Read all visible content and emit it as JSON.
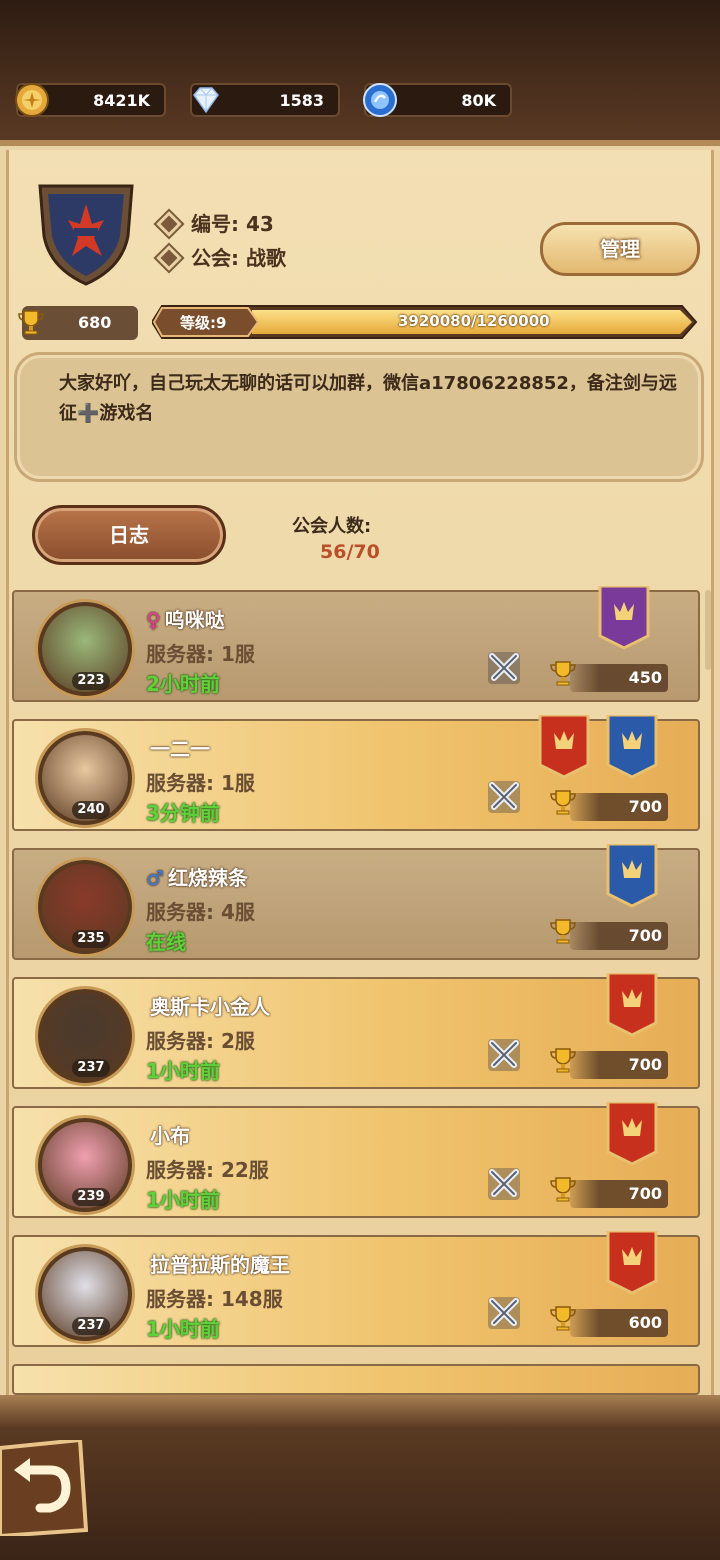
{
  "resources": [
    {
      "icon": "gold-coin-icon",
      "value": "8421K"
    },
    {
      "icon": "diamond-icon",
      "value": "1583"
    },
    {
      "icon": "blue-orb-icon",
      "value": "80K"
    }
  ],
  "guild": {
    "id_label": "编号: 43",
    "name_label": "公会: 战歌",
    "manage_label": "管理",
    "trophy_value": "680",
    "level_label": "等级:9",
    "exp_text": "3920080/1260000",
    "description": "大家好吖，自己玩太无聊的话可以加群，微信a17806228852，备注剑与远征➕游戏名",
    "log_label": "日志",
    "member_count_label": "公会人数:",
    "member_count_value": "56/70"
  },
  "members": [
    {
      "gender": "♀",
      "name": "呜咪哒",
      "server": "服务器: 1服",
      "status": "2小时前",
      "level": "223",
      "score": "450",
      "style": "plain"
    },
    {
      "gender": "",
      "name": "一二一",
      "server": "服务器: 1服",
      "status": "3分钟前",
      "level": "240",
      "score": "700",
      "style": "gold"
    },
    {
      "gender": "♂",
      "name": "红烧辣条",
      "server": "服务器: 4服",
      "status": "在线",
      "level": "235",
      "score": "700",
      "style": "plain"
    },
    {
      "gender": "",
      "name": "奥斯卡小金人",
      "server": "服务器: 2服",
      "status": "1小时前",
      "level": "237",
      "score": "700",
      "style": "gold"
    },
    {
      "gender": "",
      "name": "小布",
      "server": "服务器: 22服",
      "status": "1小时前",
      "level": "239",
      "score": "700",
      "style": "gold"
    },
    {
      "gender": "",
      "name": "拉普拉斯的魔王",
      "server": "服务器: 148服",
      "status": "1小时前",
      "level": "237",
      "score": "600",
      "style": "gold"
    }
  ],
  "colors": {
    "status_green": "#5fd23a",
    "count_red": "#b8502a",
    "female_pink": "#e0409a",
    "male_blue": "#3a7ad8"
  }
}
